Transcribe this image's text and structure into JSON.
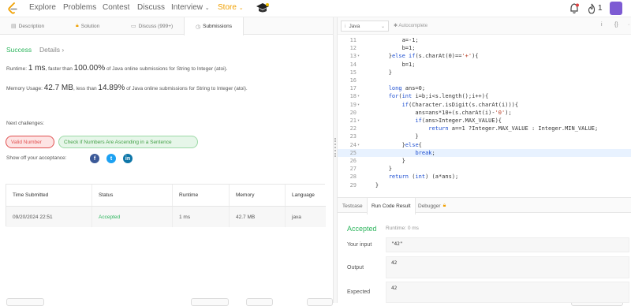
{
  "nav": {
    "items": [
      "Explore",
      "Problems",
      "Contest",
      "Discuss",
      "Interview"
    ],
    "store": "Store",
    "notification_count": "1"
  },
  "left_tabs": [
    "Description",
    "Solution",
    "Discuss (999+)",
    "Submissions"
  ],
  "submission": {
    "status": "Success",
    "details_link": "Details",
    "runtime_label": "Runtime:",
    "runtime_value": "1 ms",
    "runtime_mid": ", faster than",
    "runtime_pct": "100.00%",
    "runtime_tail": "of Java online submissions for String to Integer (atoi).",
    "memory_label": "Memory Usage:",
    "memory_value": "42.7 MB",
    "memory_mid": ", less than",
    "memory_pct": "14.89%",
    "memory_tail": "of Java online submissions for String to Integer (atoi).",
    "next_challenges_label": "Next challenges:",
    "challenges": [
      "Valid Number",
      "Check if Numbers Are Ascending in a Sentence"
    ],
    "share_label": "Show off your acceptance:"
  },
  "table": {
    "headers": [
      "Time Submitted",
      "Status",
      "Runtime",
      "Memory",
      "Language"
    ],
    "rows": [
      [
        "09/20/2024 22:51",
        "Accepted",
        "1 ms",
        "42.7 MB",
        "java"
      ]
    ]
  },
  "editor": {
    "language": "Java",
    "autocomplete": "Autocomplete",
    "lines": [
      {
        "n": "11",
        "fold": "",
        "code": "            a=-1;"
      },
      {
        "n": "12",
        "fold": "",
        "code": "            b=1;"
      },
      {
        "n": "13",
        "fold": "▾",
        "code": "        }else if(s.charAt(0)=='+'){"
      },
      {
        "n": "14",
        "fold": "",
        "code": "            b=1;"
      },
      {
        "n": "15",
        "fold": "",
        "code": "        }"
      },
      {
        "n": "16",
        "fold": "",
        "code": ""
      },
      {
        "n": "17",
        "fold": "",
        "code": "        long ans=0;"
      },
      {
        "n": "18",
        "fold": "▾",
        "code": "        for(int i=b;i<s.length();i++){"
      },
      {
        "n": "19",
        "fold": "▾",
        "code": "            if(Character.isDigit(s.charAt(i))){"
      },
      {
        "n": "20",
        "fold": "",
        "code": "                ans=ans*10+(s.charAt(i)-'0');"
      },
      {
        "n": "21",
        "fold": "▾",
        "code": "                if(ans>Integer.MAX_VALUE){"
      },
      {
        "n": "22",
        "fold": "",
        "code": "                    return a==1 ?Integer.MAX_VALUE : Integer.MIN_VALUE;"
      },
      {
        "n": "23",
        "fold": "",
        "code": "                }"
      },
      {
        "n": "24",
        "fold": "▾",
        "code": "            }else{"
      },
      {
        "n": "25",
        "fold": "",
        "code": "                break;"
      },
      {
        "n": "26",
        "fold": "",
        "code": "            }"
      },
      {
        "n": "27",
        "fold": "",
        "code": "        }"
      },
      {
        "n": "28",
        "fold": "",
        "code": "        return (int) (a*ans);"
      },
      {
        "n": "29",
        "fold": "",
        "code": "    }"
      }
    ],
    "highlighted_line": "25"
  },
  "bottom_tabs": [
    "Testcase",
    "Run Code Result",
    "Debugger"
  ],
  "result": {
    "status": "Accepted",
    "runtime": "Runtime: 0 ms",
    "input_label": "Your input",
    "input_value": "\"42\"",
    "output_label": "Output",
    "output_value": "42",
    "expected_label": "Expected",
    "expected_value": "42"
  },
  "colors": {
    "accent_green": "#2db55d",
    "store_orange": "#f0a000",
    "red_chip": "#e05050",
    "highlight_line": "#e8f2ff"
  }
}
